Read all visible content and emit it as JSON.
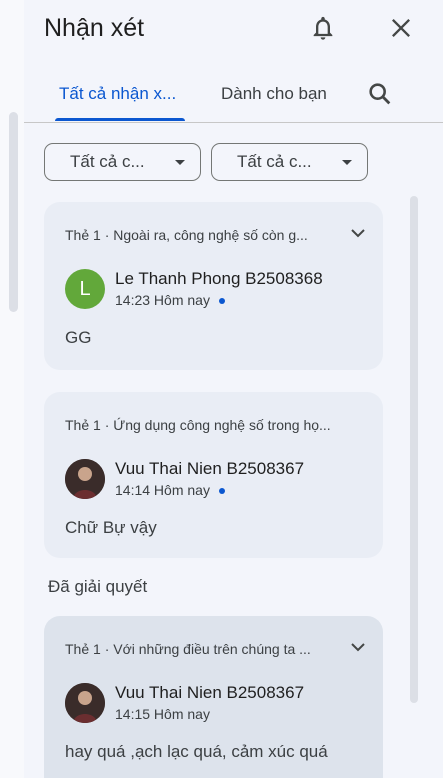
{
  "panel": {
    "title": "Nhận xét",
    "icons": {
      "notifications": "bell-icon",
      "close": "close-icon",
      "search": "search-icon",
      "expand": "chevron-down-icon"
    }
  },
  "tabs": [
    {
      "label": "Tất cả nhận x...",
      "active": true
    },
    {
      "label": "Dành cho bạn",
      "active": false
    }
  ],
  "filters": [
    {
      "value": "Tất cả c..."
    },
    {
      "value": "Tất cả c..."
    }
  ],
  "threads": [
    {
      "context": "Thẻ 1 · Ngoài ra, công nghệ số còn g...",
      "author": "Le Thanh Phong B2508368",
      "avatar_letter": "L",
      "time": "14:23 Hôm nay",
      "unread": true,
      "comment": "GG"
    },
    {
      "context": "Thẻ 1 · Ứng dụng công nghệ số trong họ...",
      "author": "Vuu Thai Nien B2508367",
      "time": "14:14 Hôm nay",
      "unread": true,
      "comment": "Chữ Bự vậy"
    }
  ],
  "resolved": {
    "heading": "Đã giải quyết",
    "threads": [
      {
        "context": "Thẻ 1 · Với những điều trên chúng ta ...",
        "author": "Vuu Thai Nien B2508367",
        "time": "14:15 Hôm nay",
        "unread": false,
        "comment": "hay quá ,ạch lạc quá, cảm xúc quá"
      }
    ]
  },
  "colors": {
    "accent": "#0b57d0",
    "panel_bg": "#f3f5fb",
    "card_bg": "#e9edf5",
    "resolved_card_bg": "#dde3ec",
    "avatar_green": "#62a83a"
  }
}
